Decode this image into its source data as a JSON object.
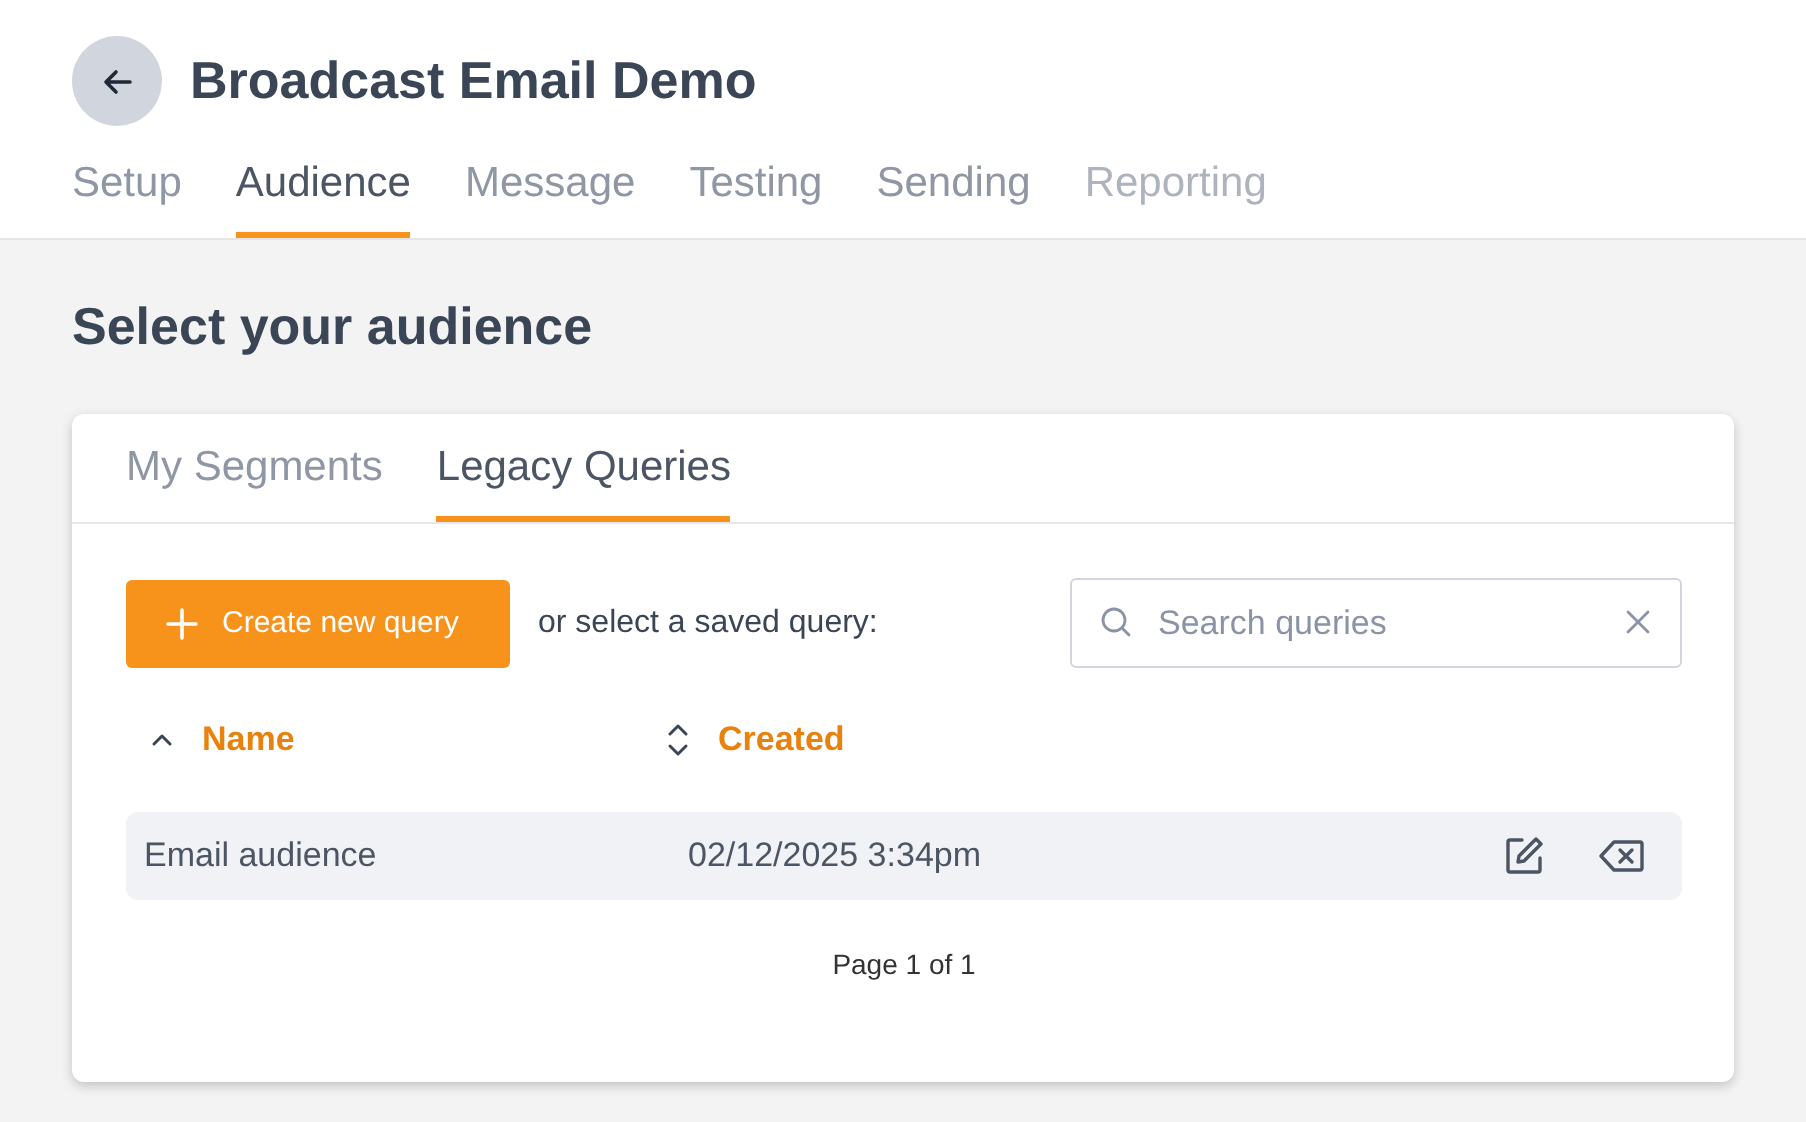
{
  "header": {
    "title": "Broadcast Email Demo"
  },
  "steps": [
    {
      "label": "Setup",
      "selected": false,
      "disabled": false
    },
    {
      "label": "Audience",
      "selected": true,
      "disabled": false
    },
    {
      "label": "Message",
      "selected": false,
      "disabled": false
    },
    {
      "label": "Testing",
      "selected": false,
      "disabled": false
    },
    {
      "label": "Sending",
      "selected": false,
      "disabled": false
    },
    {
      "label": "Reporting",
      "selected": false,
      "disabled": true
    }
  ],
  "heading": "Select your audience",
  "card": {
    "tabs": [
      {
        "label": "My Segments",
        "selected": false
      },
      {
        "label": "Legacy Queries",
        "selected": true
      }
    ],
    "create_button": "Create new query",
    "prompt": "or select a saved query:",
    "search": {
      "placeholder": "Search queries"
    },
    "columns": [
      {
        "label": "Name",
        "sorted": true
      },
      {
        "label": "Created",
        "sorted": false
      }
    ],
    "rows": [
      {
        "name": "Email audience",
        "created": "02/12/2025 3:34pm"
      }
    ],
    "pagination": "Page 1 of 1"
  }
}
